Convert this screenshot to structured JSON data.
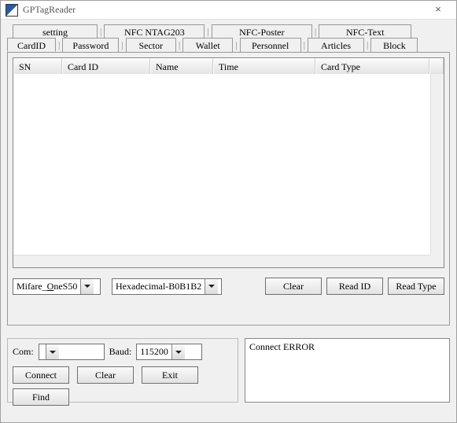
{
  "window": {
    "title": "GPTagReader"
  },
  "tabs_top": [
    {
      "label": "setting"
    },
    {
      "label": "NFC NTAG203"
    },
    {
      "label": "NFC-Poster"
    },
    {
      "label": "NFC-Text"
    }
  ],
  "tabs_bottom": [
    {
      "label": "CardID"
    },
    {
      "label": "Password"
    },
    {
      "label": "Sector"
    },
    {
      "label": "Wallet"
    },
    {
      "label": "Personnel"
    },
    {
      "label": "Articles"
    },
    {
      "label": "Block"
    }
  ],
  "table": {
    "headers": {
      "sn": "SN",
      "card_id": "Card ID",
      "name": "Name",
      "time": "Time",
      "card_type": "Card Type"
    },
    "rows": []
  },
  "selects": {
    "card_type": {
      "value": "Mifare_OneS50"
    },
    "format": {
      "value": "Hexadecimal-B0B1B2"
    }
  },
  "buttons": {
    "clear_list": "Clear",
    "read_id": "Read ID",
    "read_type": "Read Type",
    "connect": "Connect",
    "clear_conn": "Clear",
    "exit": "Exit",
    "find": "Find"
  },
  "conn": {
    "com_label": "Com:",
    "com_value": "",
    "baud_label": "Baud:",
    "baud_value": "115200"
  },
  "status": "Connect ERROR"
}
